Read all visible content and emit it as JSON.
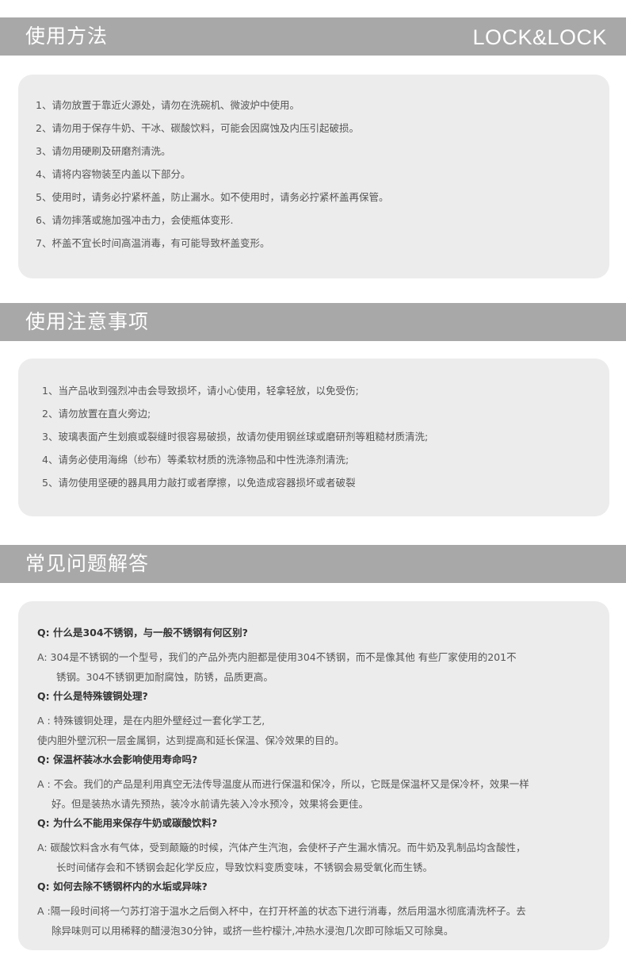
{
  "usage": {
    "title": "使用方法",
    "brand": "LOCK&LOCK",
    "items": [
      "1、请勿放置于靠近火源处，请勿在洗碗机、微波炉中使用。",
      "2、请勿用于保存牛奶、干冰、碳酸饮料，可能会因腐蚀及内压引起破损。",
      "3、请勿用硬刷及研磨剂清洗。",
      "4、请将内容物装至内盖以下部分。",
      "5、使用时，请务必拧紧杯盖，防止漏水。如不使用时，请务必拧紧杯盖再保管。",
      "6、请勿摔落或施加强冲击力，会使瓶体变形.",
      "7、杯盖不宜长时间高温消毒，有可能导致杯盖变形。"
    ]
  },
  "notes": {
    "title": "使用注意事项",
    "items": [
      "1、当产品收到强烈冲击会导致损坏，请小心使用，轻拿轻放，以免受伤;",
      "2、请勿放置在直火旁边;",
      "3、玻璃表面产生划痕或裂缝时很容易破损，故请勿使用钢丝球或磨研剂等粗糙材质清洗;",
      "4、请务必使用海绵（纱布）等柔软材质的洗涤物品和中性洗涤剂清洗;",
      "5、请勿使用坚硬的器具用力敲打或者摩擦，以免造成容器损坏或者破裂"
    ]
  },
  "faq": {
    "title": "常见问题解答",
    "items": [
      {
        "q": "Q:  什么是304不锈钢，与一般不锈钢有何区别?",
        "a1": "A:  304是不锈钢的一个型号，我们的产品外壳内胆都是使用304不锈钢，而不是像其他    有些厂家使用的201不",
        "a2": "锈钢。304不锈钢更加耐腐蚀，防锈，品质更高。"
      },
      {
        "q": "Q:  什么是特殊镀铜处理?",
        "a1": "A : 特殊镀铜处理，是在内胆外壁经过一套化学工艺,",
        "a2": "使内胆外壁沉积一层金属铜，达到提高和延长保温、保冷效果的目的。"
      },
      {
        "q": "Q:  保温杯装冰水会影响使用寿命吗?",
        "a1": "A : 不会。我们的产品是利用真空无法传导温度从而进行保温和保冷，所以，它既是保温杯又是保冷杯，效果一样",
        "a2": "好。但是装热水请先预热，装冷水前请先装入冷水预冷，效果将会更佳。"
      },
      {
        "q": "Q:  为什么不能用来保存牛奶或碳酸饮料?",
        "a1": "A:  碳酸饮料含水有气体，受到颠簸的时候，汽体产生汽泡，会使杯子产生漏水情况。而牛奶及乳制品均含酸性，",
        "a2": "长时间储存会和不锈钢会起化学反应，导致饮料变质变味，不锈钢会易受氧化而生锈。"
      },
      {
        "q": "Q:  如何去除不锈钢杯内的水垢或异味?",
        "a1": "A :隔一段时间将一勺苏打溶于温水之后倒入杯中，在打开杯盖的状态下进行消毒，然后用温水彻底清洗杯子。去",
        "a2": "除异味则可以用稀释的醋浸泡30分钟，或挤一些柠檬汁,冲热水浸泡几次即可除垢又可除臭。"
      }
    ]
  }
}
